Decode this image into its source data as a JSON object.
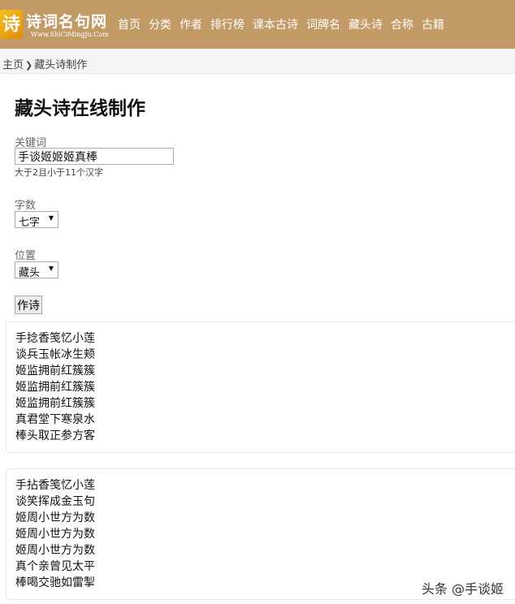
{
  "header": {
    "logo_text": "诗词名句网",
    "logo_url": "Www.ShiCiMingJu.Com",
    "nav": [
      "首页",
      "分类",
      "作者",
      "排行榜",
      "课本古诗",
      "词牌名",
      "藏头诗",
      "合称",
      "古籍"
    ]
  },
  "breadcrumb": {
    "home": "主页",
    "sep": "❯",
    "current": "藏头诗制作"
  },
  "page_title": "藏头诗在线制作",
  "form": {
    "keyword_label": "关键词",
    "keyword_value": "手谈姬姬姬真棒",
    "keyword_hint": "大于2且小于11个汉字",
    "count_label": "字数",
    "count_value": "七字",
    "position_label": "位置",
    "position_value": "藏头",
    "submit_label": "作诗"
  },
  "results": [
    [
      "手捻香笺忆小莲",
      "谈兵玉帐冰生颊",
      "姬监拥前红簇簇",
      "姬监拥前红簇簇",
      "姬监拥前红簇簇",
      "真君堂下寒泉水",
      "棒头取正参方客"
    ],
    [
      "手拈香笺忆小莲",
      "谈笑挥成金玉句",
      "姬周小世方为数",
      "姬周小世方为数",
      "姬周小世方为数",
      "真个亲曾见太平",
      "棒喝交驰如雷掣"
    ]
  ],
  "watermark": "头条 @手谈姬"
}
